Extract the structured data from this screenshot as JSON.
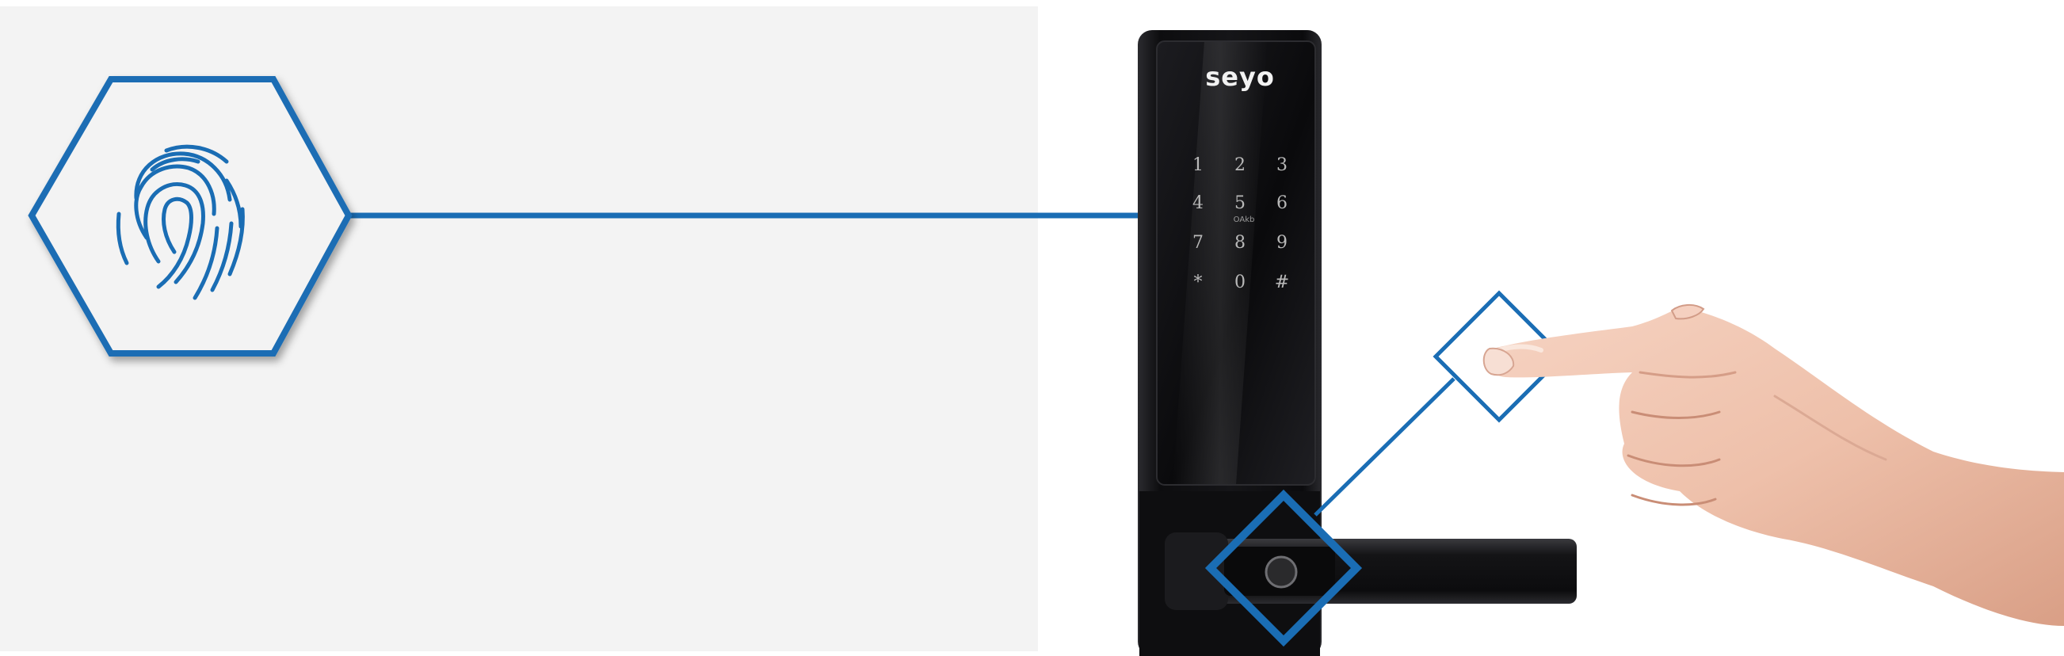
{
  "lock": {
    "brand": "seyo",
    "keypad": {
      "keys": [
        "1",
        "2",
        "3",
        "4",
        "5",
        "6",
        "7",
        "8",
        "9",
        "*",
        "0",
        "#"
      ],
      "sub_label": "OAkb"
    }
  },
  "icons": {
    "callout": "fingerprint-icon",
    "scanner_marker": "diamond-outline-icon",
    "touch_marker": "diamond-outline-icon"
  },
  "colors": {
    "accent": "#1a6db4",
    "panel_background": "#f3f3f3",
    "lock_body": "#121214",
    "skin": "#f1c7b4"
  }
}
